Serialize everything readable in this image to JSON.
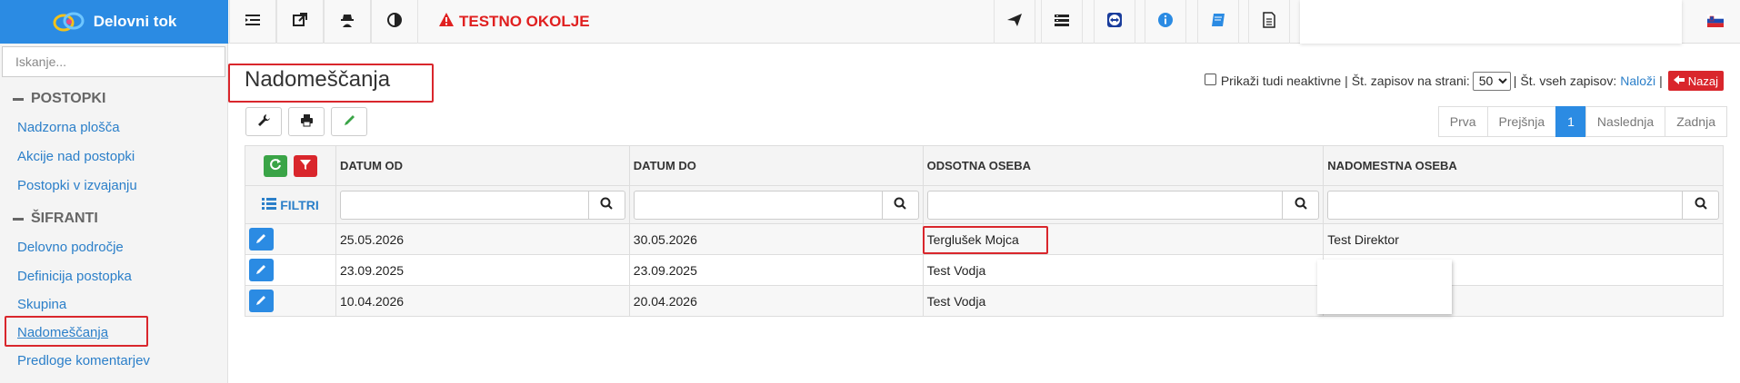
{
  "brand": {
    "name": "Delovni tok"
  },
  "topbar": {
    "warning": "TESTNO OKOLJE",
    "icons": [
      "list-indent-icon",
      "external-link-icon",
      "user-secret-icon",
      "contrast-icon",
      "paper-plane-icon",
      "server-icon",
      "teamviewer-icon",
      "info-icon",
      "book-icon",
      "document-icon",
      "slovenian-flag-icon"
    ]
  },
  "sidebar": {
    "search_placeholder": "Iskanje...",
    "sections": [
      {
        "title": "POSTOPKI",
        "items": [
          "Nadzorna plošča",
          "Akcije nad postopki",
          "Postopki v izvajanju"
        ]
      },
      {
        "title": "ŠIFRANTI",
        "items": [
          "Delovno področje",
          "Definicija postopka",
          "Skupina",
          "Nadomeščanja",
          "Predloge komentarjev"
        ]
      }
    ],
    "active_item": "Nadomeščanja"
  },
  "page": {
    "title": "Nadomeščanja",
    "show_inactive_label": "Prikaži tudi neaktivne",
    "sep1": "|",
    "per_page_label": "Št. zapisov na strani:",
    "per_page_value": "50",
    "sep2": "|",
    "total_label": "Št. vseh zapisov:",
    "total_link": "Naloži",
    "sep3": "|",
    "back_label": "Nazaj"
  },
  "pager": {
    "first": "Prva",
    "prev": "Prejšnja",
    "current": "1",
    "next": "Naslednja",
    "last": "Zadnja"
  },
  "table": {
    "columns": [
      "DATUM OD",
      "DATUM DO",
      "ODSOTNA OSEBA",
      "NADOMESTNA OSEBA"
    ],
    "filter_label": "FILTRI",
    "rows": [
      {
        "datum_od": "25.05.2026",
        "datum_do": "30.05.2026",
        "odsotna": "Terglušek Mojca",
        "nadomestna": "Test Direktor"
      },
      {
        "datum_od": "23.09.2025",
        "datum_do": "23.09.2025",
        "odsotna": "Test Vodja",
        "nadomestna": ""
      },
      {
        "datum_od": "10.04.2026",
        "datum_do": "20.04.2026",
        "odsotna": "Test Vodja",
        "nadomestna": ""
      }
    ]
  },
  "colors": {
    "brand": "#2b8be3",
    "danger": "#d9262c",
    "success": "#3aa447",
    "link": "#2b7fc9"
  }
}
